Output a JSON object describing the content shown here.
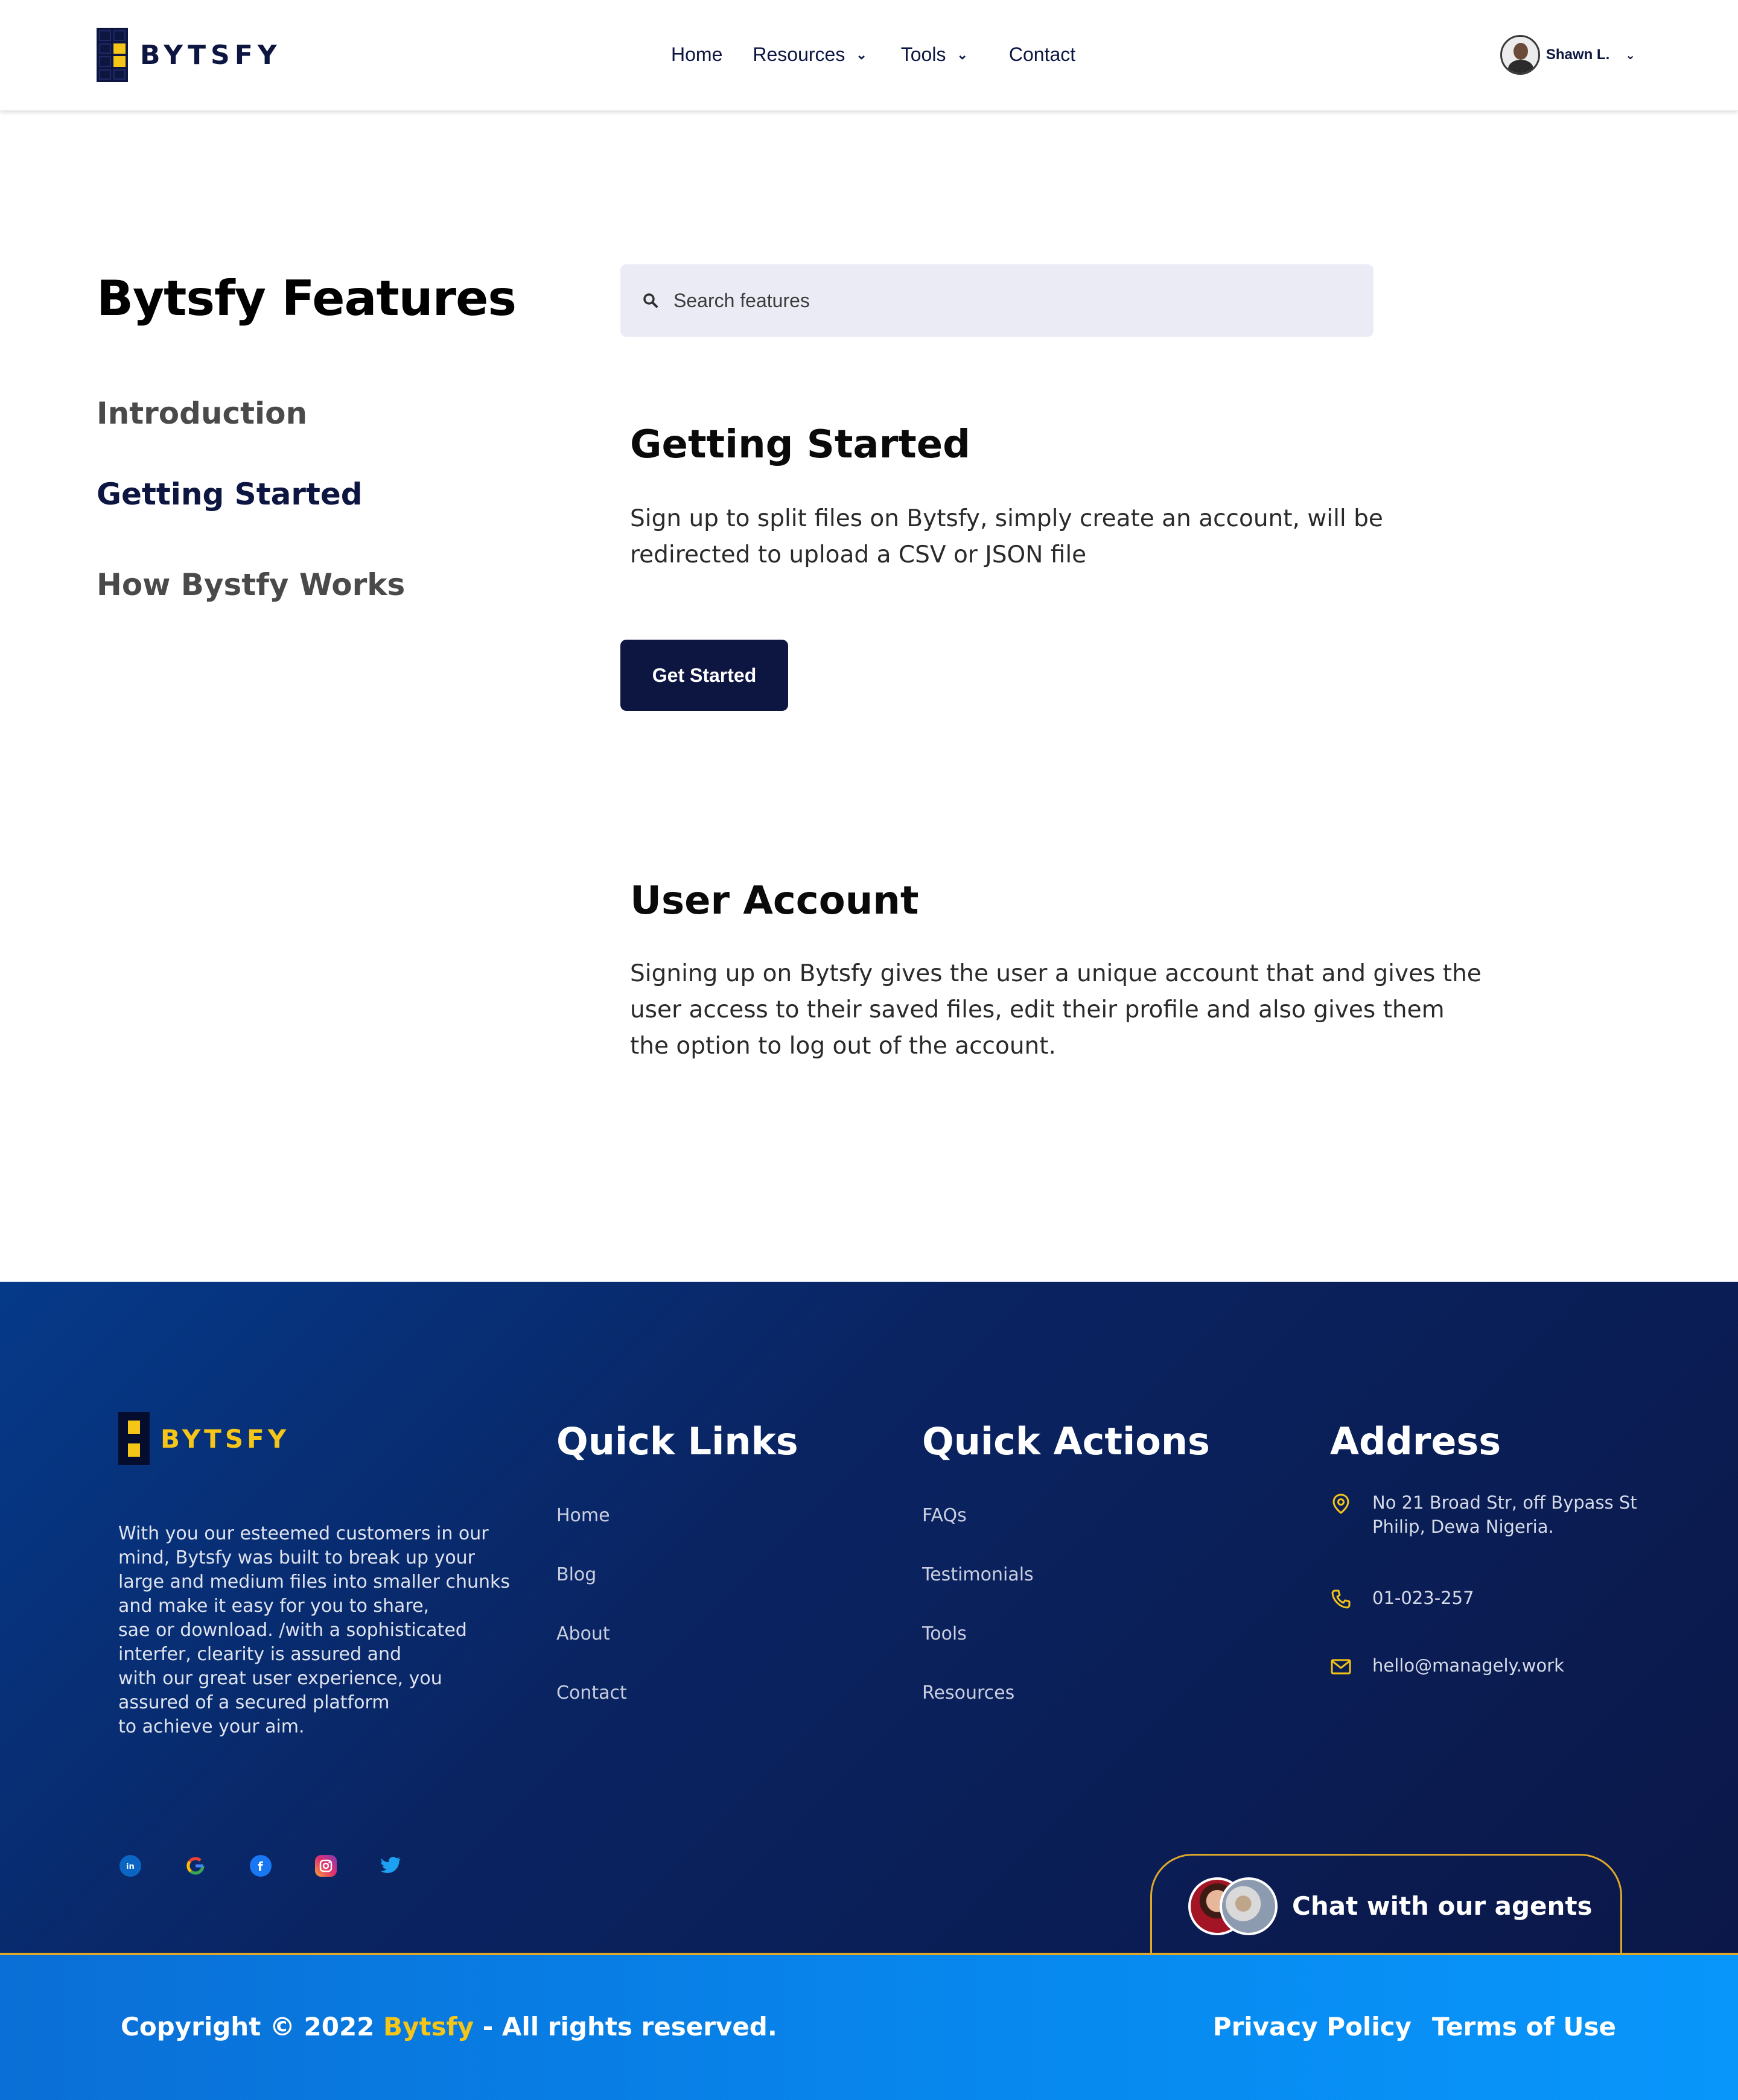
{
  "header": {
    "logo_text": "BYTSFY",
    "nav": {
      "home": "Home",
      "resources": "Resources",
      "tools": "Tools",
      "contact": "Contact"
    },
    "user_name": "Shawn L."
  },
  "sidebar": {
    "title": "Bytsfy Features",
    "items": [
      "Introduction",
      "Getting Started",
      "How Bystfy Works"
    ],
    "active": "Getting Started"
  },
  "search": {
    "placeholder": "Search features"
  },
  "sections": {
    "getting_started": {
      "title": "Getting Started",
      "text": "Sign up to split files on Bytsfy, simply create an account,  will be redirected to upload a CSV or JSON file",
      "button": "Get Started"
    },
    "user_account": {
      "title": "User Account",
      "text": "Signing up on Bytsfy gives the user a unique account that and gives the user access to their saved files, edit their profile and also gives them the option to log out of the account."
    }
  },
  "footer": {
    "logo_text": "BYTSFY",
    "about": "With you our esteemed customers in our\nmind, Bytsfy was built to break up your\nlarge and medium files into smaller chunks\nand make it easy for you to share,\nsae or download. /with a sophisticated\ninterfer, clearity is assured and\nwith our great user experience, you\nassured of a secured platform\nto achieve your aim.",
    "quick_links": {
      "title": "Quick Links",
      "items": [
        "Home",
        "Blog",
        "About",
        "Contact"
      ]
    },
    "quick_actions": {
      "title": "Quick Actions",
      "items": [
        "FAQs",
        "Testimonials",
        "Tools",
        "Resources"
      ]
    },
    "address": {
      "title": "Address",
      "street": "No 21 Broad Str, off Bypass St\nPhilip, Dewa Nigeria.",
      "phone": "01-023-257",
      "email": "hello@managely.work"
    },
    "socials": [
      "linkedin-icon",
      "google-icon",
      "facebook-icon",
      "instagram-icon",
      "twitter-icon"
    ],
    "chat_label": "Chat with our agents"
  },
  "bottom": {
    "copyright_prefix": "Copyright © 2022 ",
    "copyright_brand": "Bytsfy",
    "copyright_suffix": " - All rights reserved.",
    "privacy": "Privacy Policy",
    "terms": "Terms of Use"
  },
  "colors": {
    "navy": "#0d1541",
    "accent_yellow": "#f5c518",
    "search_bg": "#ebebf6",
    "bottom_bar_blue": "#0789ef"
  }
}
